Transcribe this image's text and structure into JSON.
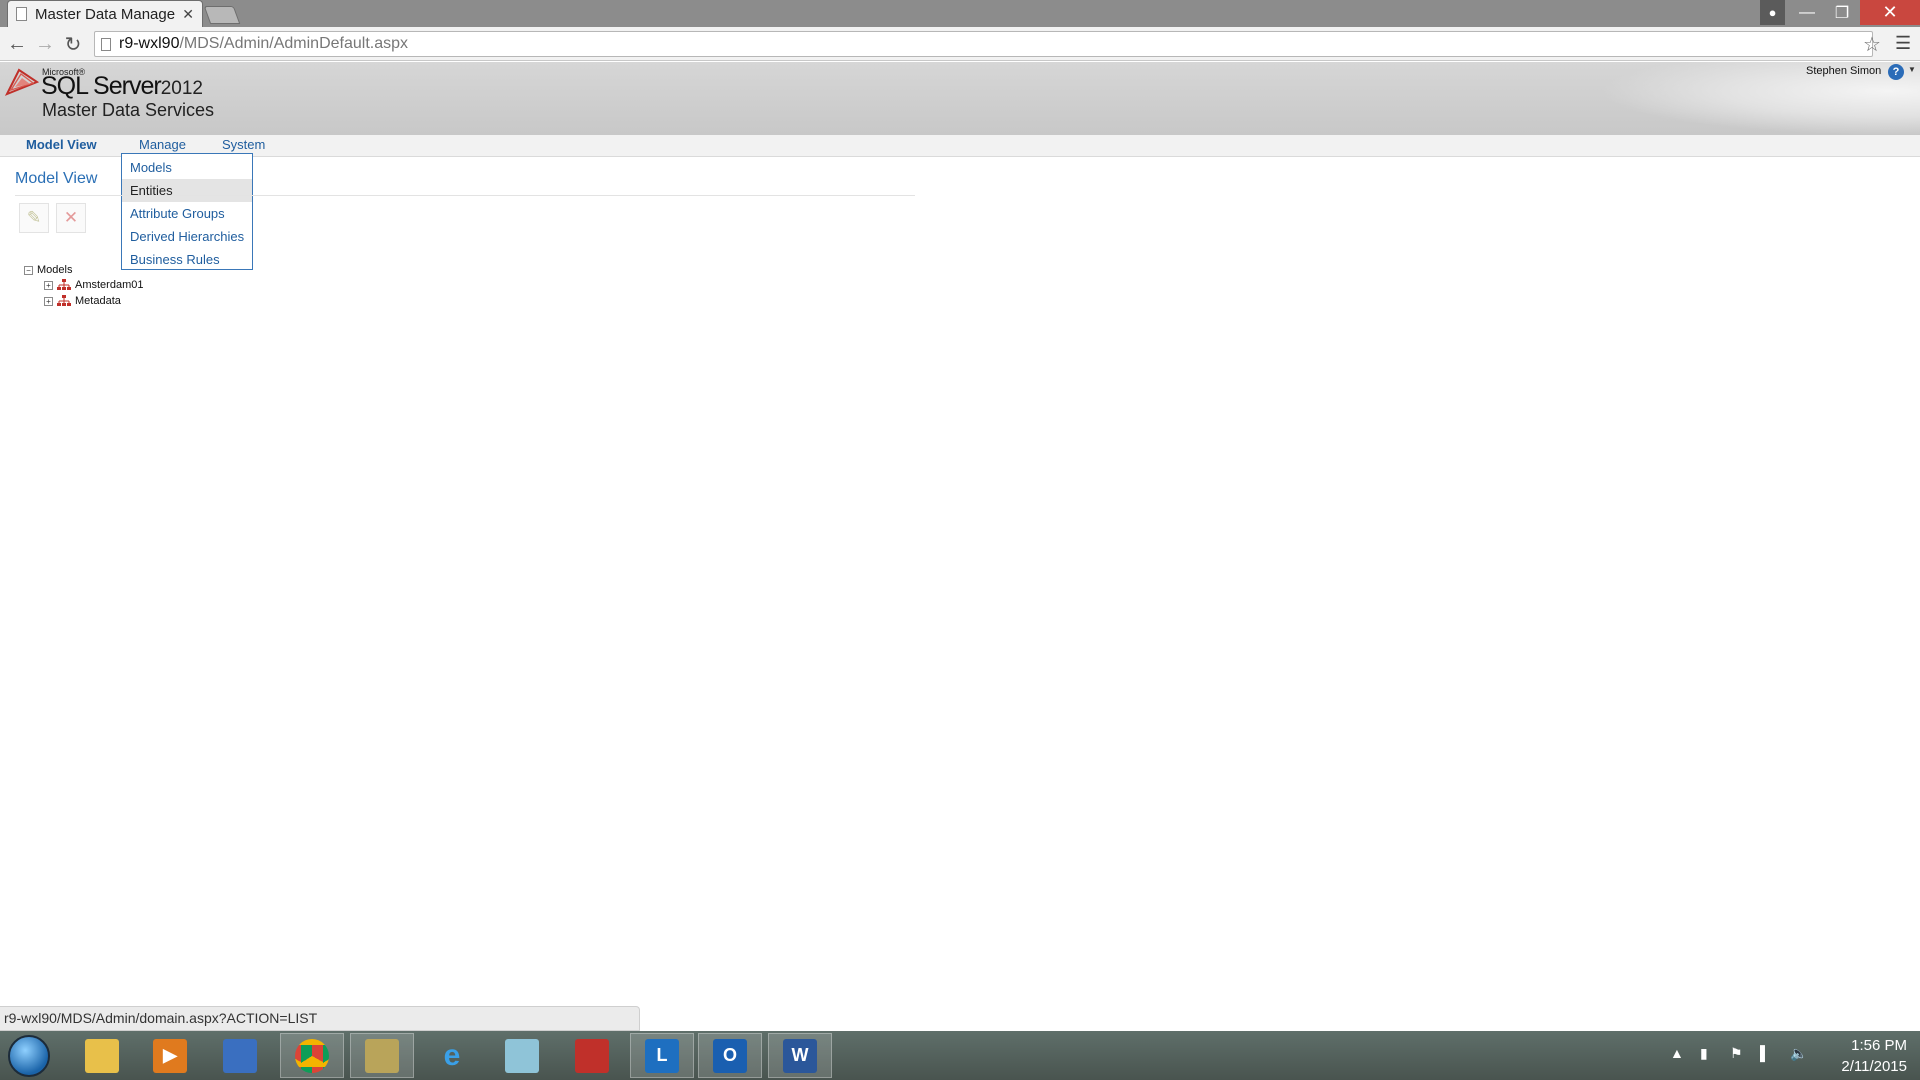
{
  "browser": {
    "tab_title": "Master Data Manage",
    "url_host": "r9-wxl90",
    "url_path": "/MDS/Admin/AdminDefault.aspx"
  },
  "header": {
    "logo_microsoft": "Microsoft®",
    "logo_product": "SQL Server",
    "logo_year": "2012",
    "logo_subtitle": "Master Data Services",
    "user_name": "Stephen Simon"
  },
  "menu": {
    "items": [
      "Model View",
      "Manage",
      "System"
    ],
    "active": "Model View",
    "dropdown": {
      "items": [
        "Models",
        "Entities",
        "Attribute Groups",
        "Derived Hierarchies",
        "Business Rules"
      ],
      "highlighted": "Entities"
    }
  },
  "page": {
    "title": "Model View",
    "tree": {
      "root": "Models",
      "children": [
        "Amsterdam01",
        "Metadata"
      ]
    }
  },
  "status_bar": {
    "link_url": "r9-wxl90/MDS/Admin/domain.aspx?ACTION=LIST"
  },
  "taskbar": {
    "time": "1:56 PM",
    "date": "2/11/2015"
  },
  "colors": {
    "link_blue": "#1f5d9e",
    "title_blue": "#2a6fb5",
    "close_red": "#c9473f"
  }
}
